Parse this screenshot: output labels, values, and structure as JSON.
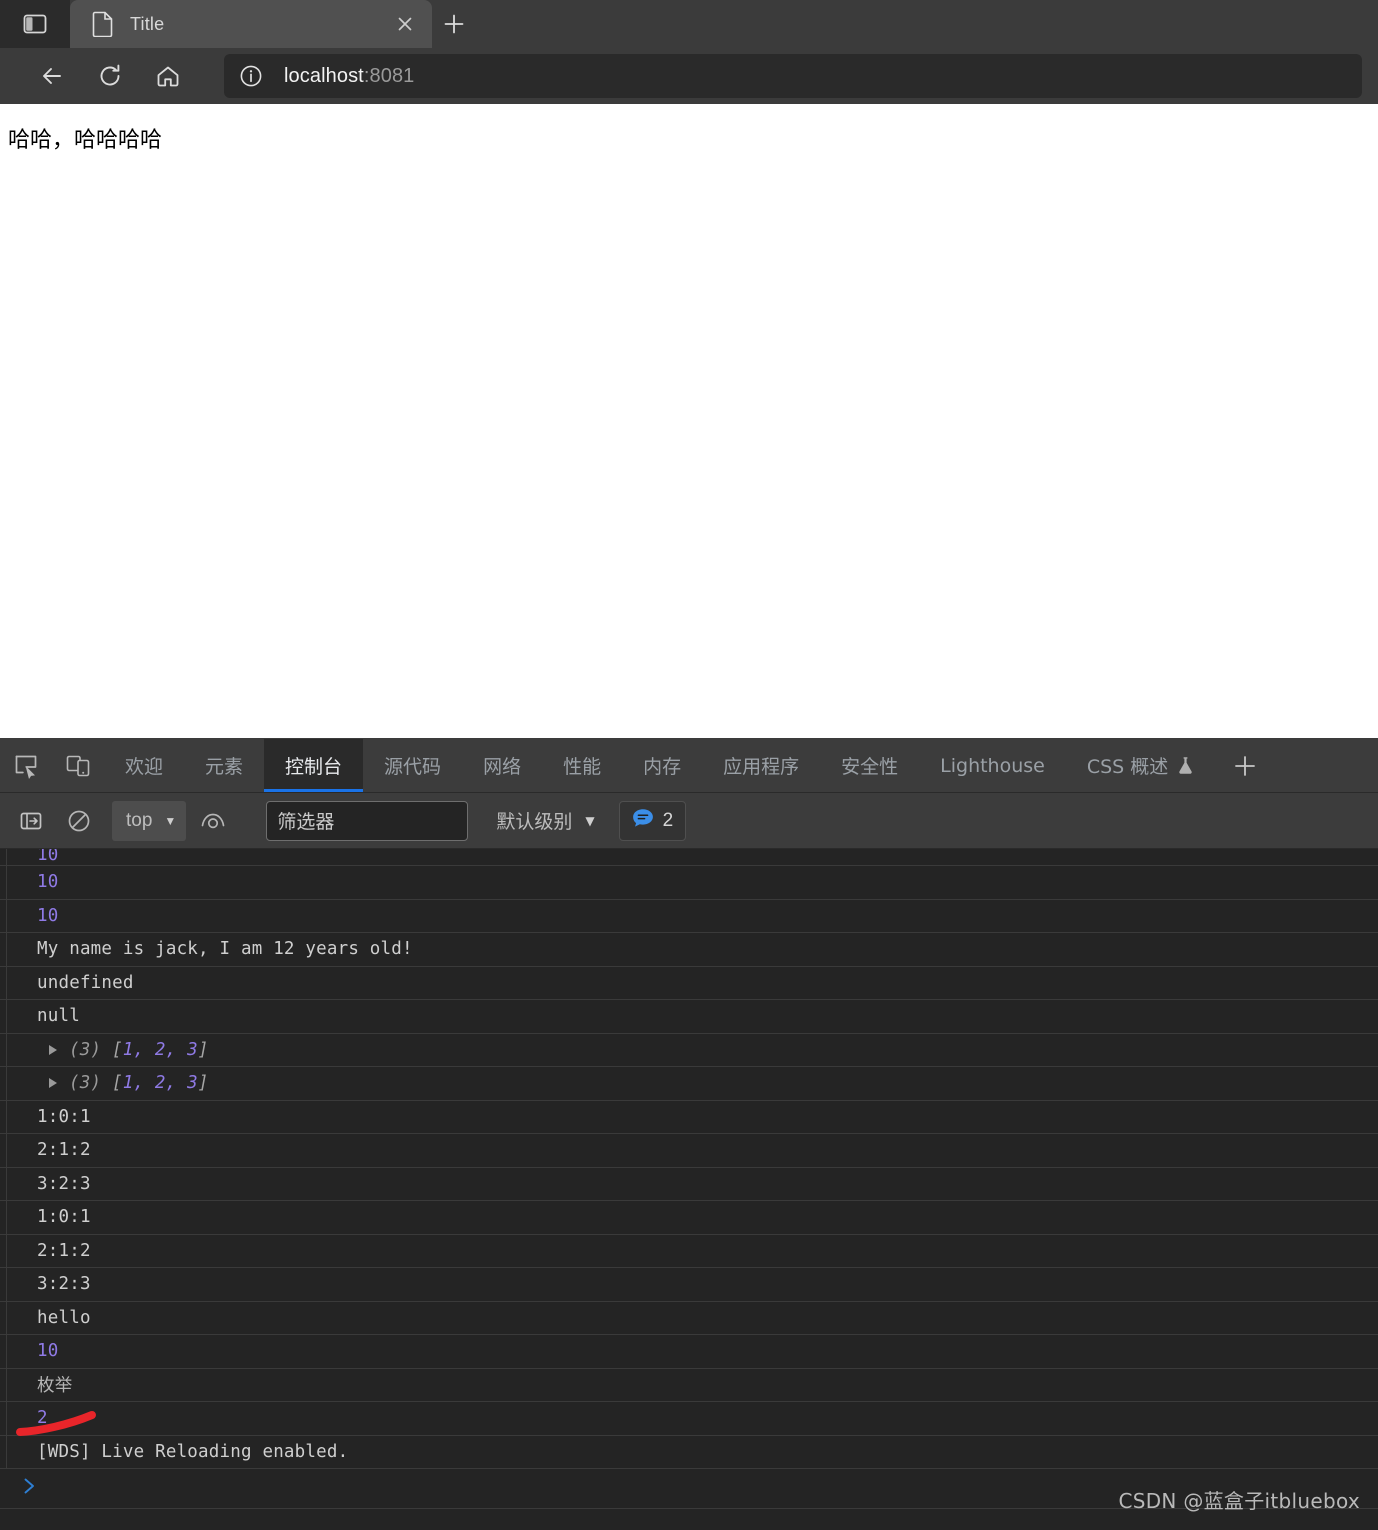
{
  "browser": {
    "sidebar_icon": "split-pane-icon",
    "tab": {
      "title": "Title",
      "doc_icon": "document-icon",
      "close_icon": "close-icon"
    },
    "newtab_label": "+",
    "nav": {
      "back_icon": "back-arrow-icon",
      "reload_icon": "reload-icon",
      "home_icon": "home-icon"
    },
    "omnibox": {
      "info_icon": "info-circle-icon",
      "host": "localhost",
      "port": ":8081"
    }
  },
  "page": {
    "body_text": "哈哈，哈哈哈哈"
  },
  "devtools": {
    "inspect_icon": "inspect-element-icon",
    "device_icon": "device-toolbar-icon",
    "tabs": [
      {
        "label": "欢迎",
        "active": false
      },
      {
        "label": "元素",
        "active": false
      },
      {
        "label": "控制台",
        "active": true
      },
      {
        "label": "源代码",
        "active": false
      },
      {
        "label": "网络",
        "active": false
      },
      {
        "label": "性能",
        "active": false
      },
      {
        "label": "内存",
        "active": false
      },
      {
        "label": "应用程序",
        "active": false
      },
      {
        "label": "安全性",
        "active": false
      },
      {
        "label": "Lighthouse",
        "active": false
      },
      {
        "label": "CSS 概述",
        "active": false,
        "icon": "flask-icon"
      }
    ],
    "more_tabs_label": "+",
    "toolbar": {
      "sidebar_icon": "console-sidebar-icon",
      "clear_icon": "clear-console-icon",
      "context_value": "top",
      "eye_icon": "live-expression-icon",
      "filter_placeholder": "筛选器",
      "filter_value": "",
      "level_label": "默认级别",
      "message_badge_icon": "message-bubble-icon",
      "message_badge_count": "2"
    },
    "console": {
      "rows": [
        {
          "kind": "number",
          "text": "10",
          "clipped": true
        },
        {
          "kind": "number",
          "text": "10"
        },
        {
          "kind": "number",
          "text": "10"
        },
        {
          "kind": "text",
          "text": "My name is jack, I am 12 years old!"
        },
        {
          "kind": "text",
          "text": "undefined"
        },
        {
          "kind": "text",
          "text": "null"
        },
        {
          "kind": "array",
          "count": "(3)",
          "items": "1, 2, 3"
        },
        {
          "kind": "array",
          "count": "(3)",
          "items": "1, 2, 3"
        },
        {
          "kind": "text",
          "text": "1:0:1"
        },
        {
          "kind": "text",
          "text": "2:1:2"
        },
        {
          "kind": "text",
          "text": "3:2:3"
        },
        {
          "kind": "text",
          "text": "1:0:1"
        },
        {
          "kind": "text",
          "text": "2:1:2"
        },
        {
          "kind": "text",
          "text": "3:2:3"
        },
        {
          "kind": "text",
          "text": "hello"
        },
        {
          "kind": "number",
          "text": "10"
        },
        {
          "kind": "cjk",
          "text": "枚举"
        },
        {
          "kind": "number",
          "text": "2"
        },
        {
          "kind": "text",
          "text": "[WDS] Live Reloading enabled."
        }
      ],
      "prompt_symbol": "❯"
    }
  },
  "annotation": {
    "color": "#e8252a",
    "shape": "hand-drawn-underline-curve"
  },
  "watermark": "CSDN @蓝盒子itbluebox",
  "colors": {
    "accent_blue": "#1a73e8",
    "number_purple": "#8f7ae5",
    "chrome_bg": "#3b3b3b",
    "devtools_bg": "#242424"
  }
}
